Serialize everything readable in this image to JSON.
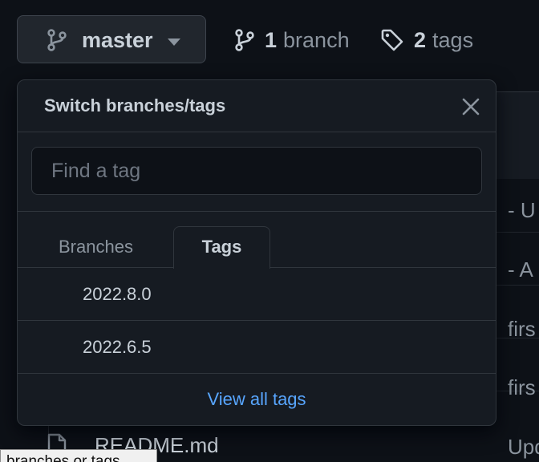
{
  "toolbar": {
    "branch_button": {
      "label": "master",
      "icon": "git-branch-icon",
      "caret": "triangle-down-icon"
    },
    "branches_link": {
      "count": "1",
      "word": "branch",
      "icon": "git-branch-icon"
    },
    "tags_link": {
      "count": "2",
      "word": "tags",
      "icon": "tag-icon"
    }
  },
  "background": {
    "commit_messages": [
      "- U",
      "- A",
      "firs",
      "firs",
      "Upd"
    ],
    "readme_file": "README.md"
  },
  "dropdown": {
    "title": "Switch branches/tags",
    "filter_placeholder": "Find a tag",
    "filter_value": "",
    "tabs": [
      {
        "label": "Branches",
        "selected": false
      },
      {
        "label": "Tags",
        "selected": true
      }
    ],
    "items": [
      {
        "label": "2022.8.0"
      },
      {
        "label": "2022.6.5"
      }
    ],
    "footer_link": "View all tags"
  },
  "tooltip": {
    "text": "branches or tags"
  },
  "colors": {
    "background": "#0d1117",
    "panel": "#161b22",
    "border": "#30363d",
    "text": "#c9d1d9",
    "muted": "#8b949e",
    "link": "#58a6ff"
  }
}
